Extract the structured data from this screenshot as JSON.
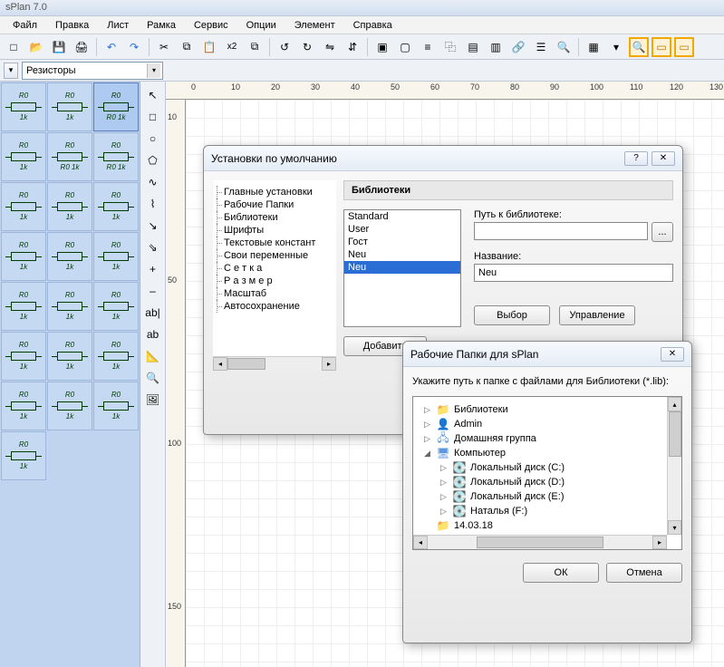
{
  "app": {
    "title": "sPlan 7.0"
  },
  "menu": [
    "Файл",
    "Правка",
    "Лист",
    "Рамка",
    "Сервис",
    "Опции",
    "Элемент",
    "Справка"
  ],
  "toolbar": {
    "new": "□",
    "open": "📂",
    "save": "💾",
    "print": "🖨",
    "undo": "↶",
    "redo": "↷",
    "cut": "✂",
    "copy": "⧉",
    "paste": "📋",
    "x2": "x2",
    "paste2": "⧉",
    "rotl": "↺",
    "rotr": "↻",
    "fliph": "⇋",
    "flipv": "⇵",
    "group": "▣",
    "ungroup": "▢",
    "align": "≡",
    "dup": "⿻",
    "lock": "▤",
    "lib": "▥",
    "link": "🔗",
    "list": "☰",
    "find": "🔍",
    "grid": "▦",
    "opt": "▾",
    "zoomfit": "🔍",
    "doc": "▭",
    "fit": "▭"
  },
  "combo": {
    "label": "Резисторы"
  },
  "palette_items": [
    {
      "t": "R0",
      "b": "1k"
    },
    {
      "t": "R0",
      "b": "1k"
    },
    {
      "t": "R0",
      "b": "R0 1k",
      "sel": true
    },
    {
      "t": "R0",
      "b": "1k"
    },
    {
      "t": "R0",
      "b": "R0 1k"
    },
    {
      "t": "R0",
      "b": "R0 1k"
    },
    {
      "t": "R0",
      "b": "1k"
    },
    {
      "t": "R0",
      "b": "1k"
    },
    {
      "t": "R0",
      "b": "1k"
    },
    {
      "t": "R0",
      "b": "1k"
    },
    {
      "t": "R0",
      "b": "1k"
    },
    {
      "t": "R0",
      "b": "1k"
    },
    {
      "t": "R0",
      "b": "1k"
    },
    {
      "t": "R0",
      "b": "1k"
    },
    {
      "t": "R0",
      "b": "1k"
    },
    {
      "t": "R0",
      "b": "1k"
    },
    {
      "t": "R0",
      "b": "1k"
    },
    {
      "t": "R0",
      "b": "1k"
    },
    {
      "t": "R0",
      "b": "1k"
    },
    {
      "t": "R0",
      "b": "1k"
    },
    {
      "t": "R0",
      "b": "1k"
    },
    {
      "t": "R0",
      "b": "1k"
    }
  ],
  "tools": [
    "↖",
    "□",
    "○",
    "⬠",
    "∿",
    "⌇",
    "↘",
    "⇘",
    "+",
    "–",
    "ab|",
    "ab",
    "📐",
    "🔍",
    "🖼"
  ],
  "ruler_h": [
    0,
    10,
    20,
    30,
    40,
    50,
    60,
    70,
    80,
    90,
    100,
    110,
    120,
    130
  ],
  "ruler_v": [
    10,
    50,
    100,
    150
  ],
  "settings_dialog": {
    "title": "Установки по умолчанию",
    "help": "?",
    "close": "✕",
    "tree": [
      "Главные установки",
      "Рабочие Папки",
      "Библиотеки",
      "Шрифты",
      "Текстовые констант",
      "Свои переменные",
      "С е т к а",
      "Р а з м е р",
      "Масштаб",
      "Автосохранение"
    ],
    "panel_title": "Библиотеки",
    "libs": [
      "Standard",
      "User",
      "Гост",
      "Neu",
      "Neu"
    ],
    "lib_sel_idx": 4,
    "path_label": "Путь к библиотеке:",
    "path_value": "",
    "browse": "...",
    "name_label": "Название:",
    "name_value": "Neu",
    "btn_select": "Выбор",
    "btn_manage": "Управление",
    "btn_add": "Добавить"
  },
  "folder_dialog": {
    "title": "Рабочие Папки для sPlan",
    "close": "✕",
    "hint": "Укажите путь к папке с файлами для Библиотеки (*.lib):",
    "nodes": [
      {
        "ind": 0,
        "exp": "▷",
        "icon": "📁",
        "color": "#4a8",
        "label": "Библиотеки"
      },
      {
        "ind": 0,
        "exp": "▷",
        "icon": "👤",
        "color": "#5b98e0",
        "label": "Admin"
      },
      {
        "ind": 0,
        "exp": "▷",
        "icon": "🖧",
        "color": "#5b98e0",
        "label": "Домашняя группа"
      },
      {
        "ind": 0,
        "exp": "◢",
        "icon": "🖥",
        "color": "#5b98e0",
        "label": "Компьютер"
      },
      {
        "ind": 1,
        "exp": "▷",
        "icon": "💽",
        "color": "#8aa",
        "label": "Локальный диск (C:)"
      },
      {
        "ind": 1,
        "exp": "▷",
        "icon": "💽",
        "color": "#8aa",
        "label": "Локальный диск (D:)"
      },
      {
        "ind": 1,
        "exp": "▷",
        "icon": "💽",
        "color": "#8aa",
        "label": "Локальный диск (E:)"
      },
      {
        "ind": 1,
        "exp": "▷",
        "icon": "💽",
        "color": "#8aa",
        "label": "Наталья (F:)"
      },
      {
        "ind": 0,
        "exp": "",
        "icon": "📁",
        "color": "#e8c050",
        "label": "14.03.18"
      }
    ],
    "ok": "ОК",
    "cancel": "Отмена"
  }
}
